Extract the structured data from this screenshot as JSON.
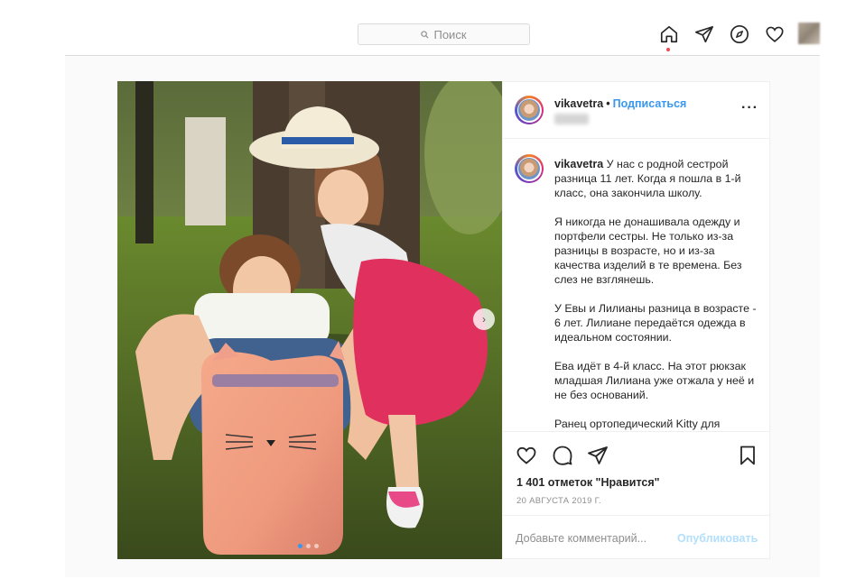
{
  "topbar": {
    "search_placeholder": "Поиск",
    "icons": [
      "home-icon",
      "direct-icon",
      "explore-icon",
      "activity-heart-icon"
    ]
  },
  "post": {
    "username": "vikavetra",
    "separator": "•",
    "follow_label": "Подписаться",
    "more_label": "···",
    "caption_username": "vikavetra",
    "caption_paragraphs": [
      "У нас с родной сестрой разница 11 лет. Когда я пошла в 1-й класс, она закончила школу.",
      "Я никогда не донашивала одежду и портфели сестры. Не только из-за разницы в возрасте, но и из-за качества изделий в те времена. Без слез не взглянешь.",
      "У Евы и Лилианы разница в возрасте - 6 лет. Лилиане передаётся одежда в идеальном состоянии.",
      "Ева идёт в 4-й класс. На этот рюкзак младшая Лилиана уже отжала у неё и не без оснований.",
      "Ранец ортопедический Kitty для"
    ],
    "likes_text": "1 401 отметок \"Нравится\"",
    "date_text": "20 АВГУСТА 2019 Г.",
    "comment_placeholder": "Добавьте комментарий...",
    "publish_label": "Опубликовать",
    "carousel_dots": 3,
    "carousel_active": 1,
    "colors": {
      "accent": "#3897f0",
      "publish_disabled": "#b2dffc",
      "notification": "#ed4956"
    }
  }
}
